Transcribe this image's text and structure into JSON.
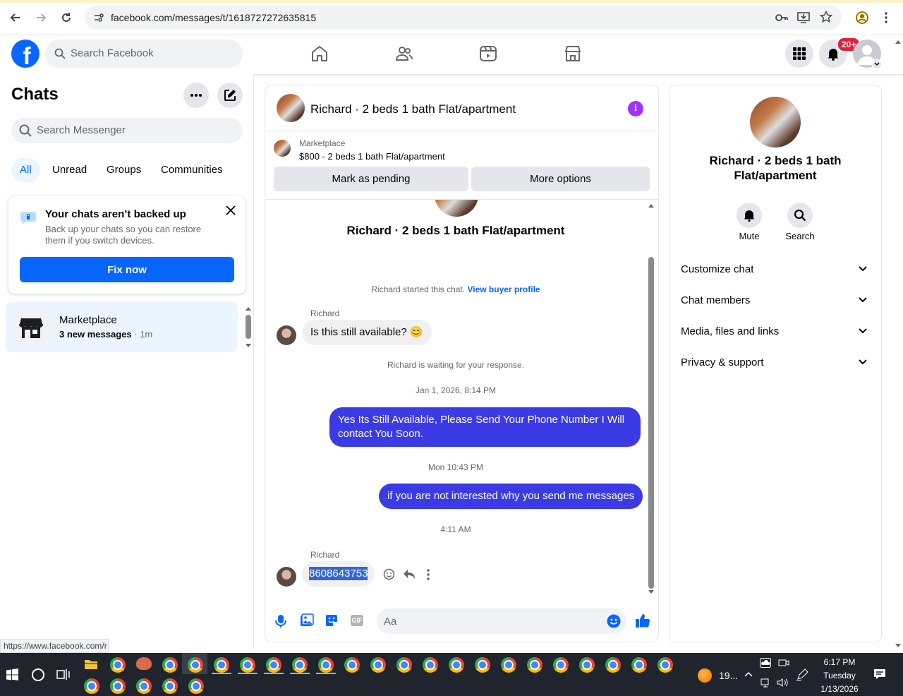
{
  "browser": {
    "url": "facebook.com/messages/t/1618727272635815",
    "status_url": "https://www.facebook.com/r"
  },
  "header": {
    "search_placeholder": "Search Facebook",
    "notifications_badge": "20+",
    "brand_color": "#0866ff"
  },
  "sidebar": {
    "title": "Chats",
    "search_placeholder": "Search Messenger",
    "filters": [
      {
        "label": "All",
        "active": true
      },
      {
        "label": "Unread",
        "active": false
      },
      {
        "label": "Groups",
        "active": false
      },
      {
        "label": "Communities",
        "active": false
      }
    ],
    "backup_card": {
      "title": "Your chats aren’t backed up",
      "description": "Back up your chats so you can restore them if you switch devices.",
      "button": "Fix now"
    },
    "conversations": [
      {
        "name": "Marketplace",
        "preview": "3 new messages",
        "time": "1m"
      }
    ]
  },
  "conversation": {
    "title": "Richard · 2 beds 1 bath Flat/apartment",
    "marketplace_label": "Marketplace",
    "listing": "$800 - 2 beds 1 bath Flat/apartment",
    "mark_pending": "Mark as pending",
    "more_options": "More options",
    "thread_title": "Richard · 2 beds 1 bath Flat/apartment",
    "started_text": "Richard started this chat.",
    "buyer_link": "View buyer profile",
    "sender_name": "Richard",
    "msg1": "Is this still available? 😊",
    "waiting_text": "Richard is waiting for your response.",
    "time1": "Jan 1, 2026, 8:14 PM",
    "msg2": "Yes Its Still Available, Please Send Your Phone Number I Will contact You Soon.",
    "time2": "Mon 10:43 PM",
    "msg3": "if you are not interested why you send me messages",
    "time3": "4:11 AM",
    "msg4": "8608643753",
    "composer_placeholder": "Aa",
    "outgoing_color": "#3b3be6"
  },
  "details": {
    "title": "Richard · 2 beds 1 bath Flat/apartment",
    "mute": "Mute",
    "search": "Search",
    "sections": [
      "Customize chat",
      "Chat members",
      "Media, files and links",
      "Privacy & support"
    ]
  },
  "taskbar": {
    "weather": "19...",
    "time": "6:17 PM",
    "day": "Tuesday",
    "date": "1/13/2026"
  }
}
